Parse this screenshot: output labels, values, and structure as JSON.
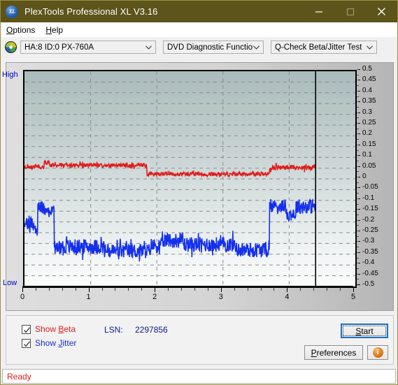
{
  "window": {
    "title": "PlexTools Professional XL V3.16",
    "icon": "XL",
    "icon_name": "plextools-logo-icon",
    "titlebar_color": "#5c541a",
    "buttons": {
      "minimize": "minimize-icon",
      "maximize": "maximize-icon",
      "close": "close-icon"
    }
  },
  "menubar": {
    "items": [
      {
        "label": "Options",
        "accel": "O"
      },
      {
        "label": "Help",
        "accel": "H"
      }
    ]
  },
  "toolbar": {
    "disc_icon": "optical-disc-icon",
    "device": {
      "value": "HA:8 ID:0  PX-760A"
    },
    "function": {
      "value": "DVD Diagnostic Functions"
    },
    "test": {
      "value": "Q-Check Beta/Jitter Test"
    }
  },
  "controls": {
    "show_beta": {
      "label": "Show Beta",
      "accel": "B",
      "checked": true,
      "color": "#e01b1b"
    },
    "show_jitter": {
      "label": "Show Jitter",
      "accel": "J",
      "checked": true,
      "color": "#1430d0"
    },
    "lsn_label": "LSN:",
    "lsn_value": "2297856",
    "start_button": {
      "label": "Start",
      "accel": "S"
    },
    "preferences_button": {
      "label": "Preferences",
      "accel": "P"
    },
    "info_button": {
      "label": "i",
      "icon": "info-icon"
    }
  },
  "statusbar": {
    "text": "Ready",
    "color": "#e01b1b"
  },
  "chart_data": {
    "type": "line",
    "title": "Q-Check Beta/Jitter Test",
    "xlabel": "",
    "ylabel": "",
    "xlim": [
      0,
      5
    ],
    "ylim": [
      -0.5,
      0.5
    ],
    "grid": true,
    "legend_position": "bottom-left",
    "left_axis_top_label": "High",
    "left_axis_bottom_label": "Low",
    "x_tick_labels": [
      "0",
      "1",
      "2",
      "3",
      "4",
      "5"
    ],
    "x_tick_values": [
      0,
      1,
      2,
      3,
      4,
      5
    ],
    "x_minor_step": 0.2,
    "y_tick_labels": [
      "0.5",
      "0.45",
      "0.4",
      "0.35",
      "0.3",
      "0.25",
      "0.2",
      "0.15",
      "0.1",
      "0.05",
      "0",
      "-0.05",
      "-0.1",
      "-0.15",
      "-0.2",
      "-0.25",
      "-0.3",
      "-0.35",
      "-0.4",
      "-0.45",
      "-0.5"
    ],
    "y_tick_values": [
      0.5,
      0.45,
      0.4,
      0.35,
      0.3,
      0.25,
      0.2,
      0.15,
      0.1,
      0.05,
      0,
      -0.05,
      -0.1,
      -0.15,
      -0.2,
      -0.25,
      -0.3,
      -0.35,
      -0.4,
      -0.45,
      -0.5
    ],
    "cursor_line_x": 4.4,
    "data_end_x": 4.4,
    "series": [
      {
        "name": "Beta",
        "color": "#e01b1b",
        "x_start": 0.0,
        "x_end": 4.4,
        "segments": [
          {
            "x0": 0.0,
            "x1": 0.3,
            "mean": 0.055,
            "noise": 0.008
          },
          {
            "x0": 0.3,
            "x1": 0.38,
            "mean": 0.075,
            "noise": 0.01
          },
          {
            "x0": 0.38,
            "x1": 1.85,
            "mean": 0.063,
            "noise": 0.01
          },
          {
            "x0": 1.85,
            "x1": 1.88,
            "mean": 0.018,
            "noise": 0.008
          },
          {
            "x0": 1.88,
            "x1": 3.7,
            "mean": 0.023,
            "noise": 0.009
          },
          {
            "x0": 3.7,
            "x1": 4.4,
            "mean": 0.053,
            "noise": 0.012
          }
        ]
      },
      {
        "name": "Jitter",
        "color": "#1430ec",
        "x_start": 0.0,
        "x_end": 4.4,
        "segments": [
          {
            "x0": 0.0,
            "x1": 0.13,
            "mean": -0.2,
            "noise": 0.03
          },
          {
            "x0": 0.13,
            "x1": 0.2,
            "mean": -0.23,
            "noise": 0.03
          },
          {
            "x0": 0.2,
            "x1": 0.33,
            "mean": -0.135,
            "noise": 0.035
          },
          {
            "x0": 0.33,
            "x1": 0.45,
            "mean": -0.145,
            "noise": 0.025
          },
          {
            "x0": 0.45,
            "x1": 1.2,
            "mean": -0.315,
            "noise": 0.035
          },
          {
            "x0": 1.2,
            "x1": 1.9,
            "mean": -0.335,
            "noise": 0.035
          },
          {
            "x0": 1.9,
            "x1": 2.1,
            "mean": -0.31,
            "noise": 0.035
          },
          {
            "x0": 2.1,
            "x1": 2.4,
            "mean": -0.285,
            "noise": 0.035
          },
          {
            "x0": 2.4,
            "x1": 3.2,
            "mean": -0.305,
            "noise": 0.035
          },
          {
            "x0": 3.2,
            "x1": 3.7,
            "mean": -0.33,
            "noise": 0.035
          },
          {
            "x0": 3.7,
            "x1": 3.95,
            "mean": -0.125,
            "noise": 0.03
          },
          {
            "x0": 3.95,
            "x1": 4.1,
            "mean": -0.165,
            "noise": 0.03
          },
          {
            "x0": 4.1,
            "x1": 4.4,
            "mean": -0.128,
            "noise": 0.035
          }
        ]
      }
    ]
  }
}
